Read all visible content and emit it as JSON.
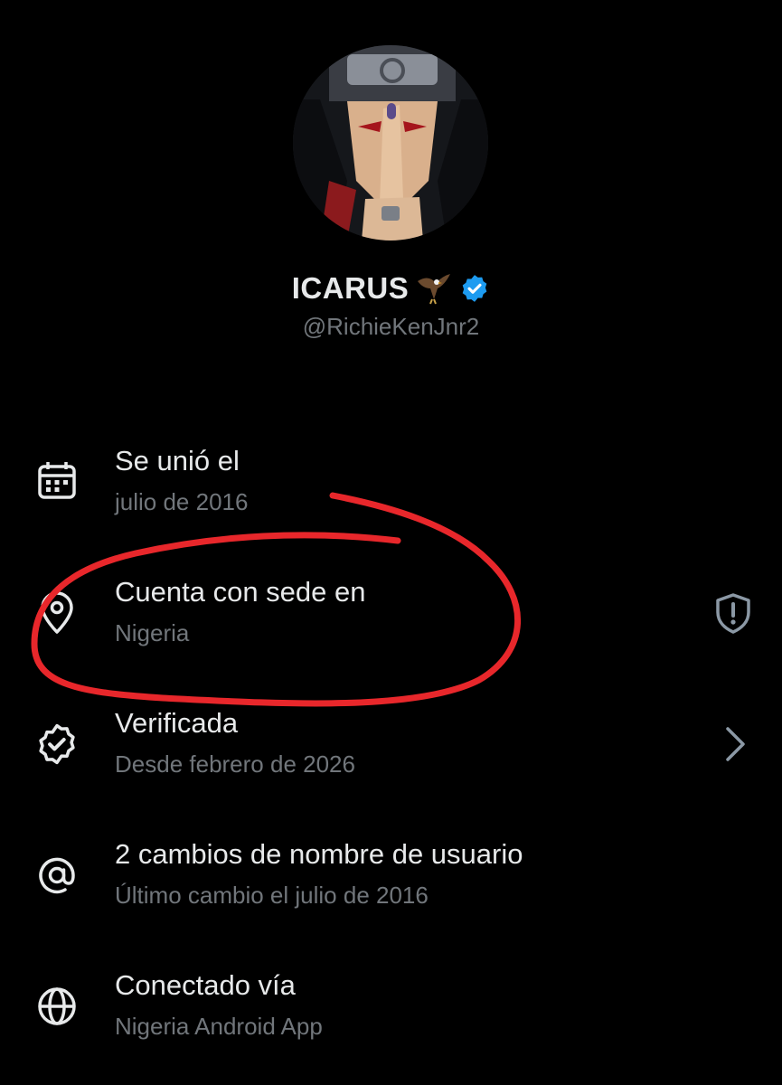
{
  "profile": {
    "display_name": "ICARUS",
    "handle": "@RichieKenJnr2",
    "avatar_icon": "avatar-image",
    "emoji_icon": "eagle-icon",
    "verified_icon": "verified-badge-icon"
  },
  "info": [
    {
      "icon": "calendar-icon",
      "title": "Se unió el",
      "subtitle": "julio de 2016"
    },
    {
      "icon": "location-pin-icon",
      "title": "Cuenta con sede en",
      "subtitle": "Nigeria",
      "right_icon": "shield-alert-icon"
    },
    {
      "icon": "verified-outline-icon",
      "title": "Verificada",
      "subtitle": "Desde febrero de 2026",
      "right_icon": "chevron-right-icon"
    },
    {
      "icon": "at-sign-icon",
      "title": "2 cambios de nombre de usuario",
      "subtitle": "Último cambio el julio de 2016"
    },
    {
      "icon": "globe-icon",
      "title": "Conectado vía",
      "subtitle": "Nigeria Android App"
    }
  ],
  "colors": {
    "background": "#000000",
    "primary_text": "#e7e9ea",
    "secondary_text": "#71767b",
    "verified_blue": "#1d9bf0",
    "annotation_red": "#e8272b"
  }
}
